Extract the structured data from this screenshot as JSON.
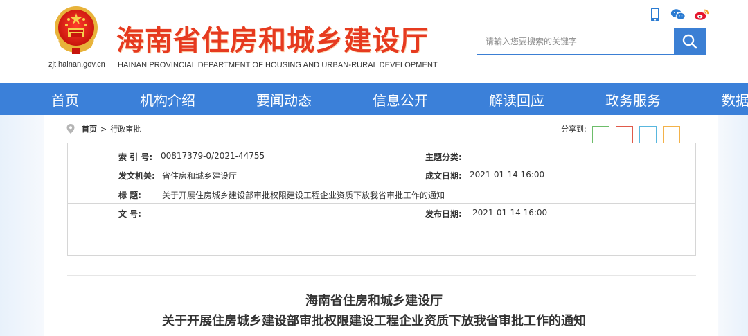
{
  "header": {
    "site_title": "海南省住房和城乡建设厅",
    "site_subtitle": "HAINAN PROVINCIAL DEPARTMENT OF HOUSING AND URBAN-RURAL DEVELOPMENT",
    "site_domain": "zjt.hainan.gov.cn",
    "icons": [
      "mobile-icon",
      "wechat-icon",
      "weibo-icon"
    ],
    "search": {
      "placeholder": "请输入您要搜索的关键字",
      "button_icon": "search-icon"
    }
  },
  "nav": {
    "items": [
      "首页",
      "机构介绍",
      "要闻动态",
      "信息公开",
      "解读回应",
      "政务服务",
      "数据开放"
    ]
  },
  "breadcrumb": {
    "home": "首页",
    "separator": ">",
    "current": "行政审批"
  },
  "share": {
    "label": "分享到:",
    "colors": [
      "#6dbd6a",
      "#e05a4a",
      "#59b7de",
      "#f3b24a"
    ]
  },
  "info": {
    "index_label": "索  引  号:",
    "index_value": "00817379-0/2021-44755",
    "topic_label": "主题分类:",
    "topic_value": "",
    "issuer_label": "发文机关:",
    "issuer_value": "省住房和城乡建设厅",
    "created_label": "成文日期:",
    "created_value": "2021-01-14 16:00",
    "title_label": "标        题:",
    "title_value": "关于开展住房城乡建设部审批权限建设工程企业资质下放我省审批工作的通知",
    "docno_label": "文        号:",
    "docno_value": "",
    "published_label": "发布日期:",
    "published_value": "2021-01-14 16:00"
  },
  "document": {
    "title_line1": "海南省住房和城乡建设厅",
    "title_line2": "关于开展住房城乡建设部审批权限建设工程企业资质下放我省审批工作的通知"
  },
  "colors": {
    "brand_red": "#e63a1f",
    "nav_blue": "#3b80d9"
  }
}
